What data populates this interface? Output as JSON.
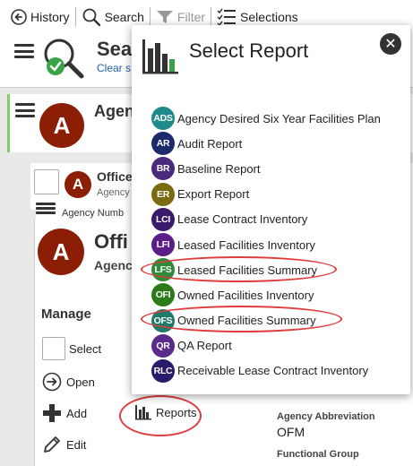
{
  "toolbar": {
    "history": "History",
    "search": "Search",
    "filter": "Filter",
    "selections": "Selections"
  },
  "search_header": {
    "title": "Sea",
    "clear": "Clear s"
  },
  "agency": {
    "avatar_letter": "A",
    "name": "Agen"
  },
  "office_row": {
    "avatar_letter": "A",
    "name": "Office",
    "sub": "Agency",
    "agency_number": "Agency Numb"
  },
  "office_card": {
    "avatar_letter": "A",
    "title": "Offi",
    "sub": "Agenc"
  },
  "manage": {
    "title": "Manage",
    "select": "Select",
    "open": "Open",
    "add": "Add",
    "edit": "Edit",
    "reports": "Reports"
  },
  "right_panel": {
    "abbr_label": "Agency Abbreviation",
    "abbr_value": "OFM",
    "functional_group_label": "Functional Group"
  },
  "modal": {
    "title": "Select Report",
    "reports": [
      {
        "badge": "ADS",
        "color": "#1f8a8c",
        "label": "Agency Desired Six Year Facilities Plan"
      },
      {
        "badge": "AR",
        "color": "#1d2a6b",
        "label": "Audit Report"
      },
      {
        "badge": "BR",
        "color": "#4a2a7c",
        "label": "Baseline Report"
      },
      {
        "badge": "ER",
        "color": "#7a6a10",
        "label": "Export Report"
      },
      {
        "badge": "LCI",
        "color": "#3a1a6a",
        "label": "Lease Contract Inventory"
      },
      {
        "badge": "LFI",
        "color": "#5a1e86",
        "label": "Leased Facilities Inventory"
      },
      {
        "badge": "LFS",
        "color": "#2f8a3a",
        "label": "Leased Facilities Summary"
      },
      {
        "badge": "OFI",
        "color": "#2c7a1a",
        "label": "Owned Facilities Inventory"
      },
      {
        "badge": "OFS",
        "color": "#1f7a6a",
        "label": "Owned Facilities Summary"
      },
      {
        "badge": "QR",
        "color": "#5a2a8c",
        "label": "QA Report"
      },
      {
        "badge": "RLC",
        "color": "#2a1a6a",
        "label": "Receivable Lease Contract Inventory"
      }
    ]
  },
  "colors": {
    "avatar": "#8b1e05",
    "highlight": "#e03c3c",
    "link": "#1f5fa8",
    "agency_accent": "#7fcf6a"
  }
}
